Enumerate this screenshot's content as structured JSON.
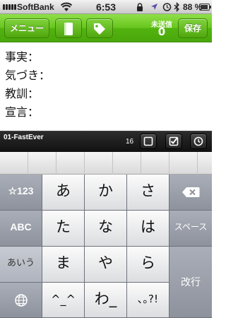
{
  "status_bar": {
    "carrier": "SoftBank",
    "time": "6:53",
    "battery": "88 %",
    "battery_level": 0.88
  },
  "toolbar": {
    "menu_label": "メニュー",
    "unsent_label": "未送信",
    "unsent_count": "0",
    "save_label": "保存"
  },
  "editor": {
    "lines": [
      "事実：",
      "気づき：",
      "教訓：",
      "宣言："
    ]
  },
  "accessory": {
    "title": "01-FastEver",
    "char_count": "16"
  },
  "keyboard": {
    "left_keys": [
      "☆123",
      "ABC",
      "あいう"
    ],
    "rows": [
      [
        "あ",
        "か",
        "さ"
      ],
      [
        "た",
        "な",
        "は"
      ],
      [
        "ま",
        "や",
        "ら"
      ],
      [
        "^_^",
        "わ_",
        "､｡?!"
      ]
    ],
    "space_label": "スペース",
    "return_label": "改行"
  }
}
